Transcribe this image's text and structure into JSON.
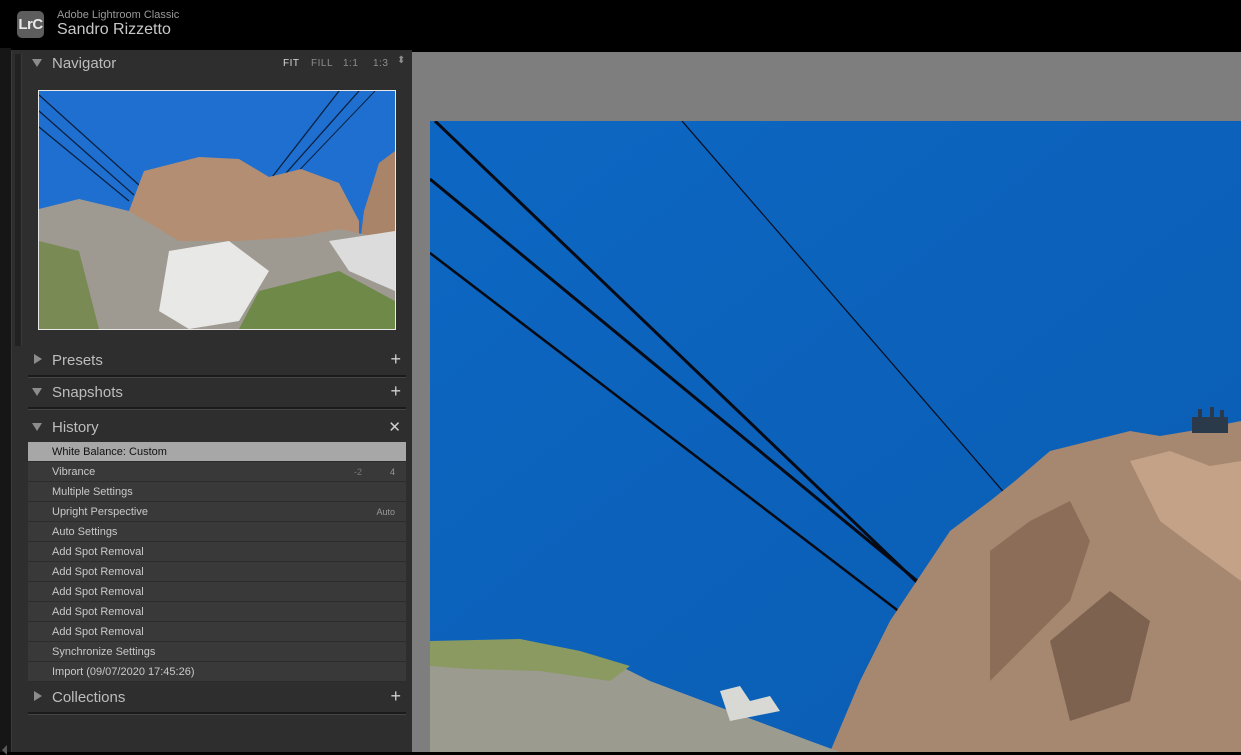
{
  "app": {
    "logo_text": "LrC",
    "name": "Adobe Lightroom Classic",
    "user": "Sandro Rizzetto"
  },
  "navigator": {
    "title": "Navigator",
    "zoom_options": [
      "FIT",
      "FILL",
      "1:1",
      "1:3"
    ],
    "selected_zoom": "FIT"
  },
  "panels": {
    "presets": "Presets",
    "snapshots": "Snapshots",
    "history": "History",
    "collections": "Collections"
  },
  "history": [
    {
      "label": "White Balance: Custom",
      "v1": "",
      "v2": "",
      "selected": true
    },
    {
      "label": "Vibrance",
      "v1": "-2",
      "v2": "4"
    },
    {
      "label": "Multiple Settings",
      "v1": "",
      "v2": ""
    },
    {
      "label": "Upright Perspective",
      "v1": "",
      "v2": "Auto"
    },
    {
      "label": "Auto Settings",
      "v1": "",
      "v2": ""
    },
    {
      "label": "Add Spot Removal",
      "v1": "",
      "v2": ""
    },
    {
      "label": "Add Spot Removal",
      "v1": "",
      "v2": ""
    },
    {
      "label": "Add Spot Removal",
      "v1": "",
      "v2": ""
    },
    {
      "label": "Add Spot Removal",
      "v1": "",
      "v2": ""
    },
    {
      "label": "Add Spot Removal",
      "v1": "",
      "v2": ""
    },
    {
      "label": "Synchronize Settings",
      "v1": "",
      "v2": ""
    },
    {
      "label": "Import (09/07/2020 17:45:26)",
      "v1": "",
      "v2": ""
    }
  ],
  "colors": {
    "sky": "#0a63bd",
    "panel": "#2e2e2e",
    "selected_row": "#a7a7a7"
  }
}
